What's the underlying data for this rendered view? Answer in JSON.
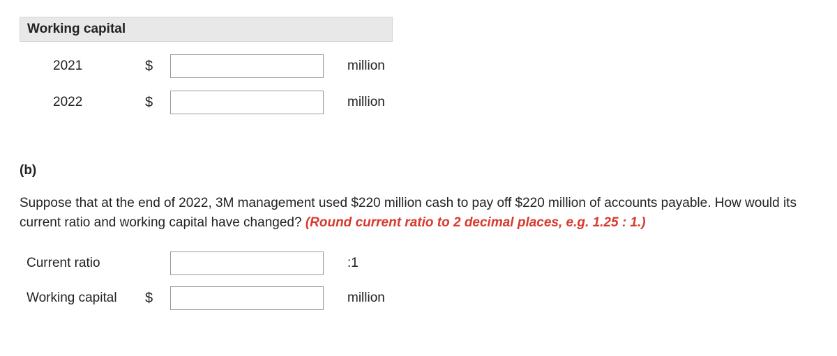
{
  "section_a": {
    "header": "Working capital",
    "rows": [
      {
        "label": "2021",
        "prefix": "$",
        "value": "",
        "suffix": "million"
      },
      {
        "label": "2022",
        "prefix": "$",
        "value": "",
        "suffix": "million"
      }
    ]
  },
  "part_b_label": "(b)",
  "paragraph_main": "Suppose that at the end of 2022, 3M management used $220 million cash to pay off $220 million of accounts payable. How would its current ratio and working capital have changed? ",
  "paragraph_hint": "(Round current ratio to 2 decimal places, e.g. 1.25 : 1.)",
  "section_b": {
    "rows": [
      {
        "label": "Current ratio",
        "prefix": "",
        "value": "",
        "suffix": ":1"
      },
      {
        "label": "Working capital",
        "prefix": "$",
        "value": "",
        "suffix": "million"
      }
    ]
  }
}
